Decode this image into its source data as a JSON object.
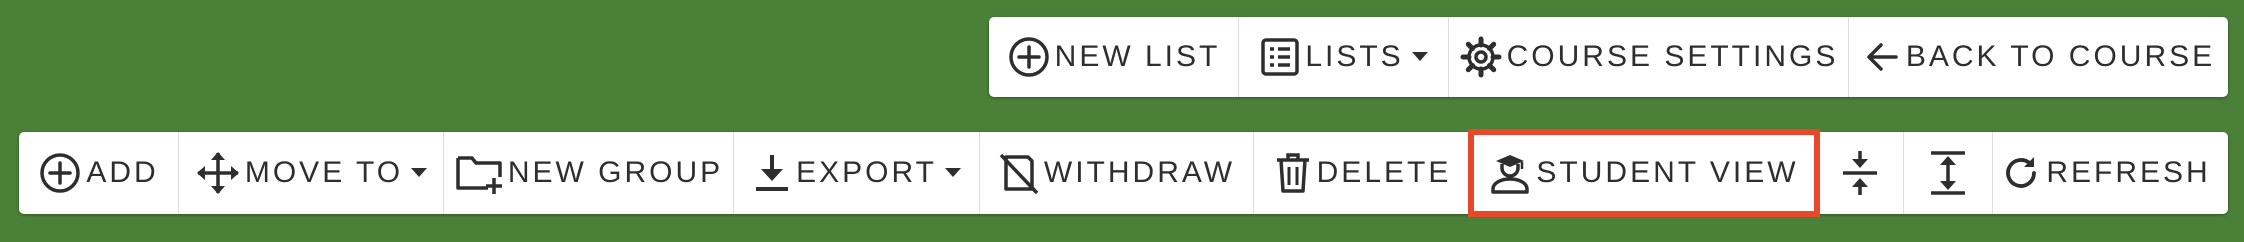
{
  "top_toolbar": {
    "new_list": "NEW LIST",
    "lists": "LISTS",
    "course_settings": "COURSE SETTINGS",
    "back_to_course": "BACK TO COURSE"
  },
  "bottom_toolbar": {
    "add": "ADD",
    "move_to": "MOVE TO",
    "new_group": "NEW GROUP",
    "export": "EXPORT",
    "withdraw": "WITHDRAW",
    "delete": "DELETE",
    "student_view": "STUDENT VIEW",
    "refresh": "REFRESH"
  },
  "colors": {
    "background": "#4a8038",
    "highlight": "#e8472b"
  },
  "icons": {
    "new_list": "plus-circle-icon",
    "lists": "list-icon",
    "course_settings": "gear-icon",
    "back_to_course": "arrow-left-icon",
    "add": "plus-circle-icon",
    "move_to": "move-arrows-icon",
    "new_group": "folder-plus-icon",
    "export": "download-icon",
    "withdraw": "withdraw-icon",
    "delete": "trash-icon",
    "student_view": "student-icon",
    "collapse": "collapse-icon",
    "expand": "expand-icon",
    "refresh": "refresh-icon"
  }
}
